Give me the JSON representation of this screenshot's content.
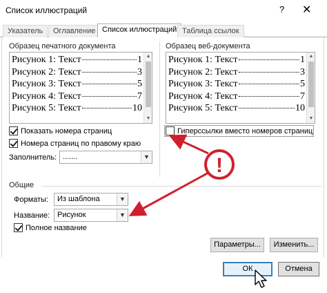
{
  "window": {
    "title": "Список иллюстраций",
    "help_label": "?",
    "close_label": "✕"
  },
  "tabs": [
    {
      "label": "Указатель",
      "active": false
    },
    {
      "label": "Оглавление",
      "active": false
    },
    {
      "label": "Список иллюстраций",
      "active": true
    },
    {
      "label": "Таблица ссылок",
      "active": false
    }
  ],
  "print_preview": {
    "label": "Образец печатного документа",
    "lines": [
      {
        "text": "Рисунок 1: Текст",
        "page": "1"
      },
      {
        "text": "Рисунок 2: Текст",
        "page": "3"
      },
      {
        "text": "Рисунок 3: Текст",
        "page": "5"
      },
      {
        "text": "Рисунок 4: Текст",
        "page": "7"
      },
      {
        "text": "Рисунок 5: Текст",
        "page": "10"
      }
    ]
  },
  "web_preview": {
    "label": "Образец веб-документа",
    "lines": [
      {
        "text": "Рисунок 1: Текст",
        "page": "1"
      },
      {
        "text": "Рисунок 2: Текст",
        "page": "3"
      },
      {
        "text": "Рисунок 3: Текст",
        "page": "5"
      },
      {
        "text": "Рисунок 4: Текст",
        "page": "7"
      },
      {
        "text": "Рисунок 5: Текст",
        "page": "10"
      }
    ]
  },
  "options": {
    "show_page_numbers": {
      "label": "Показать номера страниц",
      "checked": true
    },
    "right_align_page_numbers": {
      "label": "Номера страниц по правому краю",
      "checked": true
    },
    "hyperlinks_instead": {
      "label": "Гиперссылки вместо номеров страниц",
      "checked": false
    },
    "tab_leader_label": "Заполнитель:",
    "tab_leader_value": "......."
  },
  "general": {
    "label": "Общие",
    "formats_label": "Форматы:",
    "formats_value": "Из шаблона",
    "caption_label": "Название:",
    "caption_value": "Рисунок",
    "full_caption": {
      "label": "Полное название",
      "checked": true
    }
  },
  "buttons": {
    "parameters": "Параметры...",
    "modify": "Изменить...",
    "ok": "ОК",
    "cancel": "Отмена"
  },
  "annotation": {
    "symbol": "!",
    "color": "#d0202c"
  },
  "colors": {
    "primary_button_border": "#3c7fb1",
    "primary_button_bg": "#e5f1fb"
  }
}
